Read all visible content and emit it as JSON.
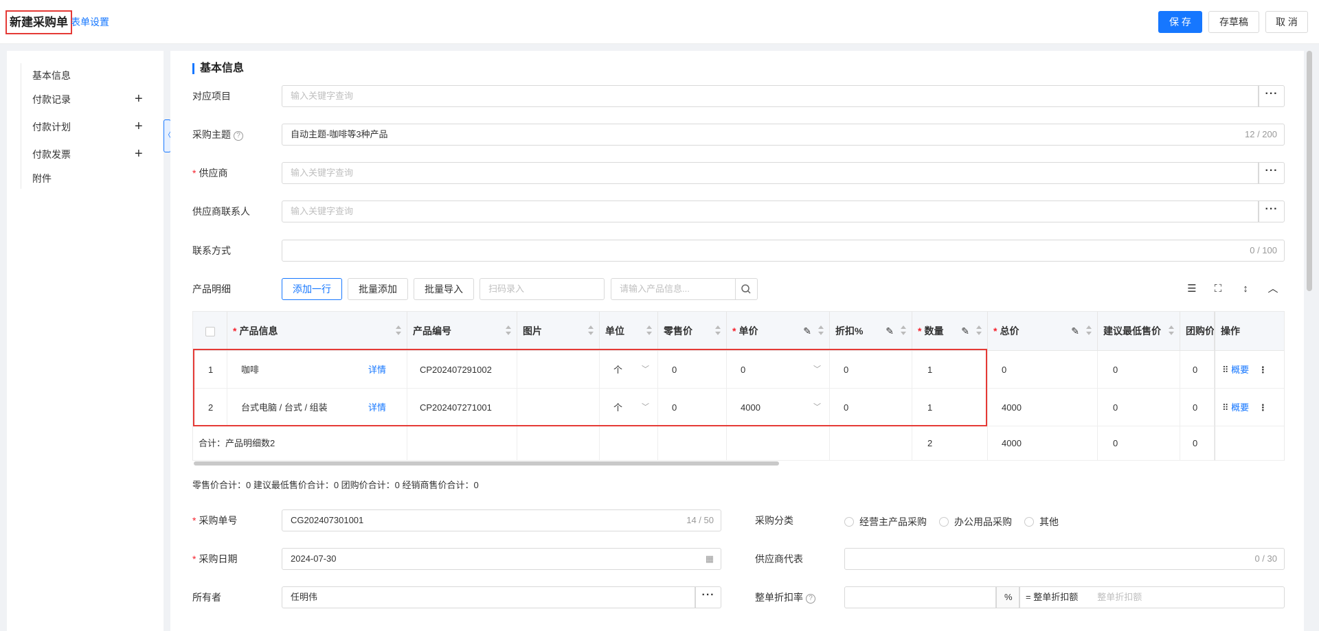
{
  "header": {
    "title": "新建采购单",
    "form_setting": "表单设置",
    "save": "保 存",
    "draft": "存草稿",
    "cancel": "取 消"
  },
  "sidebar": {
    "items": [
      {
        "label": "基本信息",
        "plus": false
      },
      {
        "label": "付款记录",
        "plus": true
      },
      {
        "label": "付款计划",
        "plus": true
      },
      {
        "label": "付款发票",
        "plus": true
      },
      {
        "label": "附件",
        "plus": false
      }
    ]
  },
  "section": {
    "title": "基本信息"
  },
  "fields": {
    "project": {
      "label": "对应项目",
      "placeholder": "输入关键字查询"
    },
    "subject": {
      "label": "采购主题",
      "value": "自动主题-咖啡等3种产品",
      "count": "12 / 200"
    },
    "supplier": {
      "label": "供应商",
      "placeholder": "输入关键字查询"
    },
    "contact": {
      "label": "供应商联系人",
      "placeholder": "输入关键字查询"
    },
    "contact_way": {
      "label": "联系方式",
      "count": "0 / 100"
    }
  },
  "products": {
    "label": "产品明细",
    "add_row": "添加一行",
    "batch_add": "批量添加",
    "batch_import": "批量导入",
    "scan_placeholder": "扫码录入",
    "search_placeholder": "请输入产品信息...",
    "columns": [
      "产品信息",
      "产品编号",
      "图片",
      "单位",
      "零售价",
      "单价",
      "折扣%",
      "数量",
      "总价",
      "建议最低售价",
      "团购价",
      "操作"
    ],
    "rows": [
      {
        "no": "1",
        "name": "咖啡",
        "detail": "详情",
        "code": "CP202407291002",
        "unit": "个",
        "retail": "0",
        "price": "0",
        "discount": "0",
        "qty": "1",
        "total": "0",
        "min_price": "0",
        "group_price": "0",
        "op": "概要"
      },
      {
        "no": "2",
        "name": "台式电脑 / 台式 / 组装",
        "detail": "详情",
        "code": "CP202407271001",
        "unit": "个",
        "retail": "0",
        "price": "4000",
        "discount": "0",
        "qty": "1",
        "total": "4000",
        "min_price": "0",
        "group_price": "0",
        "op": "概要"
      }
    ],
    "footer": {
      "label": "合计：产品明细数2",
      "qty": "2",
      "total": "4000",
      "min_price": "0",
      "group_price": "0"
    },
    "summary": "零售价合计：0  建议最低售价合计：0  团购价合计：0  经销商售价合计：0"
  },
  "order": {
    "no_label": "采购单号",
    "no_value": "CG202407301001",
    "no_count": "14 / 50",
    "category_label": "采购分类",
    "category_options": [
      "经营主产品采购",
      "办公用品采购",
      "其他"
    ],
    "date_label": "采购日期",
    "date_value": "2024-07-30",
    "rep_label": "供应商代表",
    "rep_count": "0 / 30",
    "owner_label": "所有者",
    "owner_value": "任明伟",
    "discount_label": "整单折扣率",
    "percent": "%",
    "discount_amount_label": "= 整单折扣额",
    "discount_amount_placeholder": "整单折扣额"
  },
  "colors": {
    "accent": "#1677ff",
    "highlight": "#e53935"
  }
}
